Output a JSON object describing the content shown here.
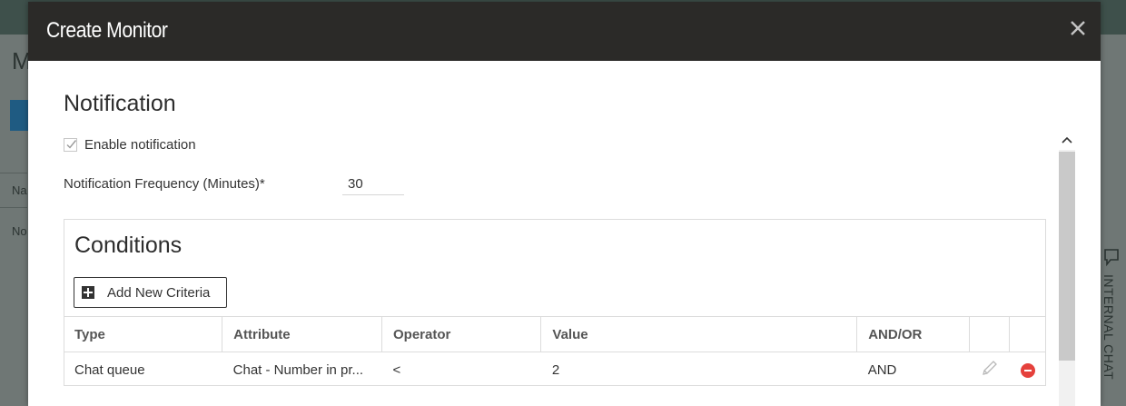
{
  "background": {
    "letters": [
      "M",
      "Na",
      "No"
    ],
    "side_tab_label": "INTERNAL CHAT"
  },
  "modal": {
    "title": "Create Monitor",
    "close_icon": "close-icon"
  },
  "notification": {
    "section_title": "Notification",
    "enable_label": "Enable notification",
    "enabled": true,
    "frequency_label": "Notification Frequency (Minutes)*",
    "frequency_value": "30"
  },
  "conditions": {
    "title": "Conditions",
    "add_button_label": "Add New Criteria",
    "columns": [
      "Type",
      "Attribute",
      "Operator",
      "Value",
      "AND/OR"
    ],
    "rows": [
      {
        "type": "Chat queue",
        "attribute": "Chat - Number in pr...",
        "operator": "<",
        "value": "2",
        "and_or": "AND"
      }
    ]
  },
  "colors": {
    "header_bg": "#2b2a28",
    "remove_icon": "#e5413c",
    "overlay_bg": "#6f7775"
  }
}
